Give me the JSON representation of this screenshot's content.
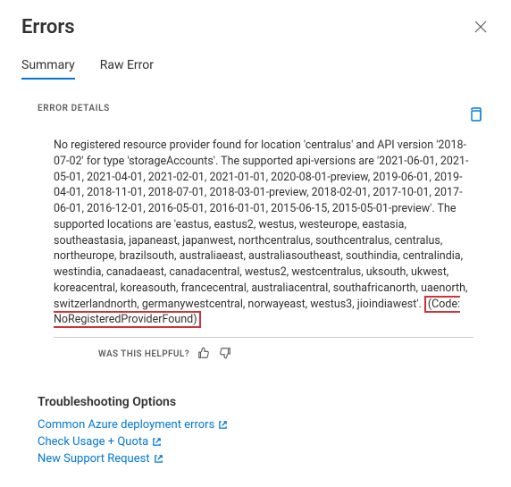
{
  "header": {
    "title": "Errors"
  },
  "tabs": {
    "summary": "Summary",
    "rawError": "Raw Error"
  },
  "errorDetails": {
    "label": "ERROR DETAILS",
    "message_pre": "No registered resource provider found for location 'centralus' and API version '2018-07-02' for type 'storageAccounts'. The supported api-versions are '2021-06-01, 2021-05-01, 2021-04-01, 2021-02-01, 2021-01-01, 2020-08-01-preview, 2019-06-01, 2019-04-01, 2018-11-01, 2018-07-01, 2018-03-01-preview, 2018-02-01, 2017-10-01, 2017-06-01, 2016-12-01, 2016-05-01, 2016-01-01, 2015-06-15, 2015-05-01-preview'. The supported locations are 'eastus, eastus2, westus, westeurope, eastasia, southeastasia, japaneast, japanwest, northcentralus, southcentralus, centralus, northeurope, brazilsouth, australiaeast, australiasoutheast, southindia, centralindia, westindia, canadaeast, canadacentral, westus2, westcentralus, uksouth, ukwest, koreacentral, koreasouth, francecentral, australiacentral, southafricanorth, uaenorth, switzerlandnorth, germanywestcentral, norwayeast, westus3, jioindiawest'. ",
    "code_text": "(Code: NoRegisteredProviderFound)"
  },
  "feedback": {
    "prompt": "WAS THIS HELPFUL?"
  },
  "troubleshooting": {
    "heading": "Troubleshooting Options",
    "links": {
      "commonErrors": "Common Azure deployment errors",
      "checkUsage": "Check Usage + Quota",
      "newSupport": "New Support Request"
    }
  }
}
